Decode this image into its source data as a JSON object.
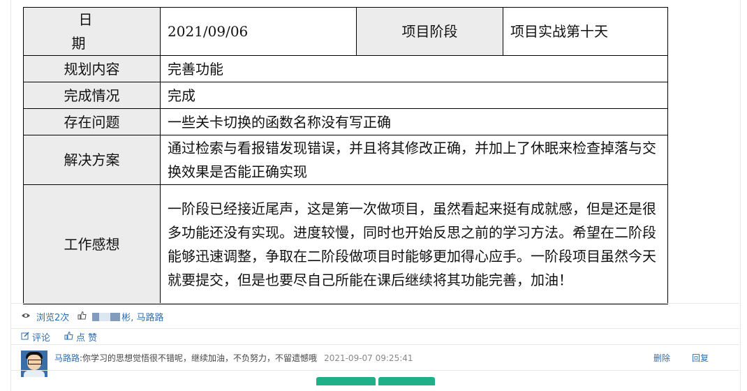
{
  "report": {
    "date_label": "日 期",
    "date_value": "2021/09/06",
    "stage_label": "项目阶段",
    "stage_value": "项目实战第十天",
    "rows": [
      {
        "label": "规划内容",
        "value": "完善功能"
      },
      {
        "label": "完成情况",
        "value": "完成"
      },
      {
        "label": "存在问题",
        "value": "一些关卡切换的函数名称没有写正确"
      },
      {
        "label": "解决方案",
        "value": "通过检索与看报错发现错误，并且将其修改正确，并加上了休眠来检查掉落与交换效果是否能正确实现"
      },
      {
        "label": "工作感想",
        "value": "一阶段已经接近尾声，这是第一次做项目，虽然看起来挺有成就感，但是还是很多功能还没有实现。进度较慢，同时也开始反思之前的学习方法。希望在二阶段能够迅速调整，争取在二阶段做项目时能够更加得心应手。一阶段项目虽然今天就要提交，但是也要尽自己所能在课后继续将其功能完善，加油！"
      }
    ]
  },
  "stats": {
    "views": "浏览2次",
    "likers": "彬, 马路路"
  },
  "actions": {
    "comment": "评论",
    "like": "点 赞"
  },
  "comment": {
    "user": "马路路",
    "text": ":你学习的思想觉悟很不错呢，继续加油，不负努力，不留遗憾哦",
    "time": "2021-09-07 09:25:41",
    "delete": "删除",
    "reply": "回复"
  },
  "icons": {
    "views": "eye-icon",
    "likes": "thumbs-up-icon",
    "comment": "edit-icon",
    "like": "thumbs-up-icon"
  },
  "colors": {
    "link": "#2f6fb0",
    "label_bg": "#ececec",
    "button": "#1fb08a"
  }
}
